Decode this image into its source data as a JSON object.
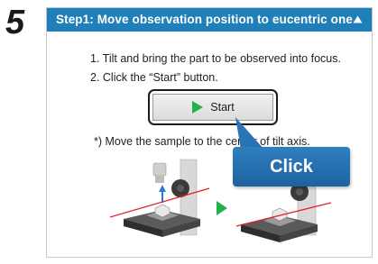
{
  "step": {
    "number": "5"
  },
  "panel": {
    "title": "Step1: Move observation position to eucentric one",
    "header_color": "#1f7fb8",
    "collapse_icon": "triangle-up-icon"
  },
  "instructions": [
    "1. Tilt and bring the part to be observed into focus.",
    "2. Click the “Start” button."
  ],
  "start_button": {
    "label": "Start",
    "icon": "play-icon",
    "icon_color": "#22b14c"
  },
  "note": "*) Move the sample to the center of tilt axis.",
  "illustration": {
    "arrow_icon": "play-icon",
    "accent": "#22b14c"
  },
  "callout": {
    "label": "Click",
    "color": "#2a73b5"
  }
}
